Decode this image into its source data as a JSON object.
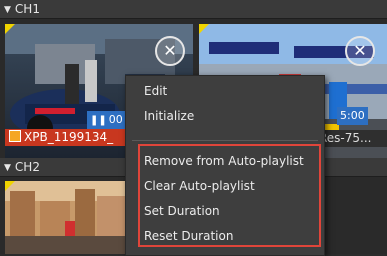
{
  "channels": [
    {
      "label": "CH1"
    },
    {
      "label": "CH2"
    }
  ],
  "ch1_tiles": [
    {
      "filename": "XPB_1199134_",
      "duration": "00",
      "thumbnail": "race-car-pit"
    },
    {
      "filename": "Res-75...",
      "duration": "5:00",
      "thumbnail": "starting-grid"
    }
  ],
  "context_menu": {
    "items": [
      "Edit",
      "Initialize",
      "Remove from Auto-playlist",
      "Clear Auto-playlist",
      "Set Duration",
      "Reset Duration"
    ]
  },
  "colors": {
    "highlight": "#e0453a",
    "corner_marker": "#f0d400",
    "duration_badge": "#2d6fc2",
    "filename_bar": "#c8371f"
  }
}
